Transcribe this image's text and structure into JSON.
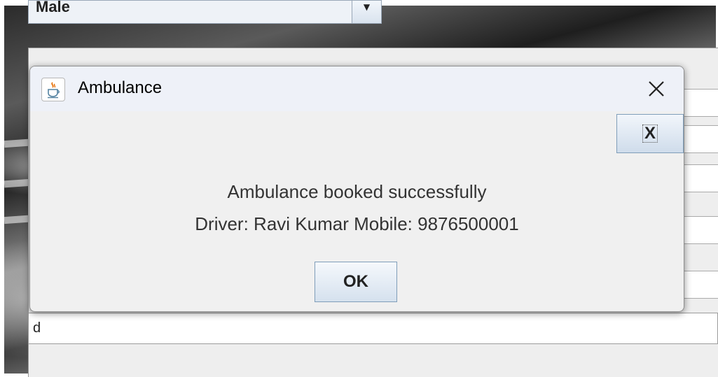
{
  "background_app": {
    "gender_select_value": "Male",
    "text_field_value": "d"
  },
  "dialog": {
    "title": "Ambulance",
    "icon": "java-cup-icon",
    "x_button_label": "X",
    "message_line1": "Ambulance booked successfully",
    "message_line2": "Driver: Ravi Kumar Mobile: 9876500001",
    "ok_label": "OK"
  },
  "colors": {
    "dialog_bg": "#f0f0f0",
    "titlebar_bg": "#eef1f8",
    "button_border": "#7f9db9"
  }
}
